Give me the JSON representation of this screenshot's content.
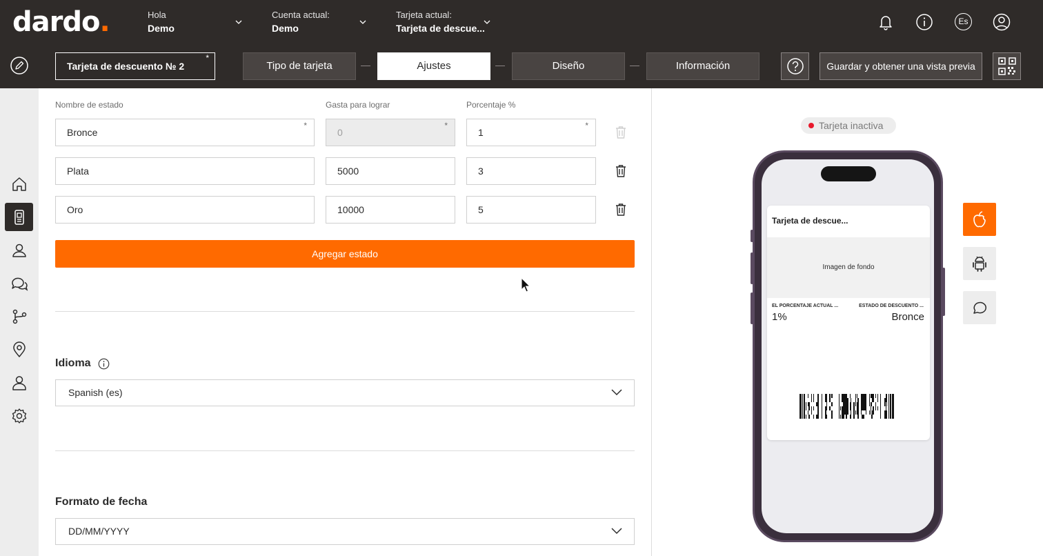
{
  "header": {
    "logo_main": "dardo",
    "logo_dot": ".",
    "greeting_label": "Hola",
    "greeting_name": "Demo",
    "account_label": "Cuenta actual:",
    "account_value": "Demo",
    "card_label": "Tarjeta actual:",
    "card_value": "Tarjeta de descue...",
    "language_badge": "Es"
  },
  "toolbar": {
    "card_name": "Tarjeta de descuento № 2",
    "required_mark": "*",
    "steps": [
      {
        "label": "Tipo de tarjeta",
        "active": false
      },
      {
        "label": "Ajustes",
        "active": true
      },
      {
        "label": "Diseño",
        "active": false
      },
      {
        "label": "Información",
        "active": false
      }
    ],
    "save_label": "Guardar y obtener una vista previa"
  },
  "sidebar": {
    "items": [
      "home-icon",
      "card-icon",
      "clients-icon",
      "messages-icon",
      "flows-icon",
      "location-icon",
      "user-icon",
      "settings-icon"
    ],
    "active_index": 1
  },
  "statuses": {
    "columns": {
      "name": "Nombre de estado",
      "spend": "Gasta para lograr",
      "percent": "Porcentaje %"
    },
    "rows": [
      {
        "name": "Bronce",
        "spend": "0",
        "percent": "1",
        "name_required": "*",
        "spend_required": "*",
        "percent_required": "*"
      },
      {
        "name": "Plata",
        "spend": "5000",
        "percent": "3"
      },
      {
        "name": "Oro",
        "spend": "10000",
        "percent": "5"
      }
    ],
    "add_label": "Agregar estado"
  },
  "language": {
    "title": "Idioma",
    "value": "Spanish (es)"
  },
  "date_format": {
    "title": "Formato de fecha",
    "value": "DD/MM/YYYY"
  },
  "preview": {
    "status": "Tarjeta inactiva",
    "pass_title": "Tarjeta de descue...",
    "background_label": "Imagen de fondo",
    "field1_label": "EL PORCENTAJE ACTUAL ...",
    "field1_value": "1%",
    "field2_label": "ESTADO DE DESCUENTO ...",
    "field2_value": "Bronce",
    "platforms": [
      "apple-icon",
      "android-icon",
      "message-icon"
    ]
  },
  "colors": {
    "accent": "#ff6a00",
    "header_bg": "#2f2b29",
    "inactive_dot": "#e8192c"
  }
}
